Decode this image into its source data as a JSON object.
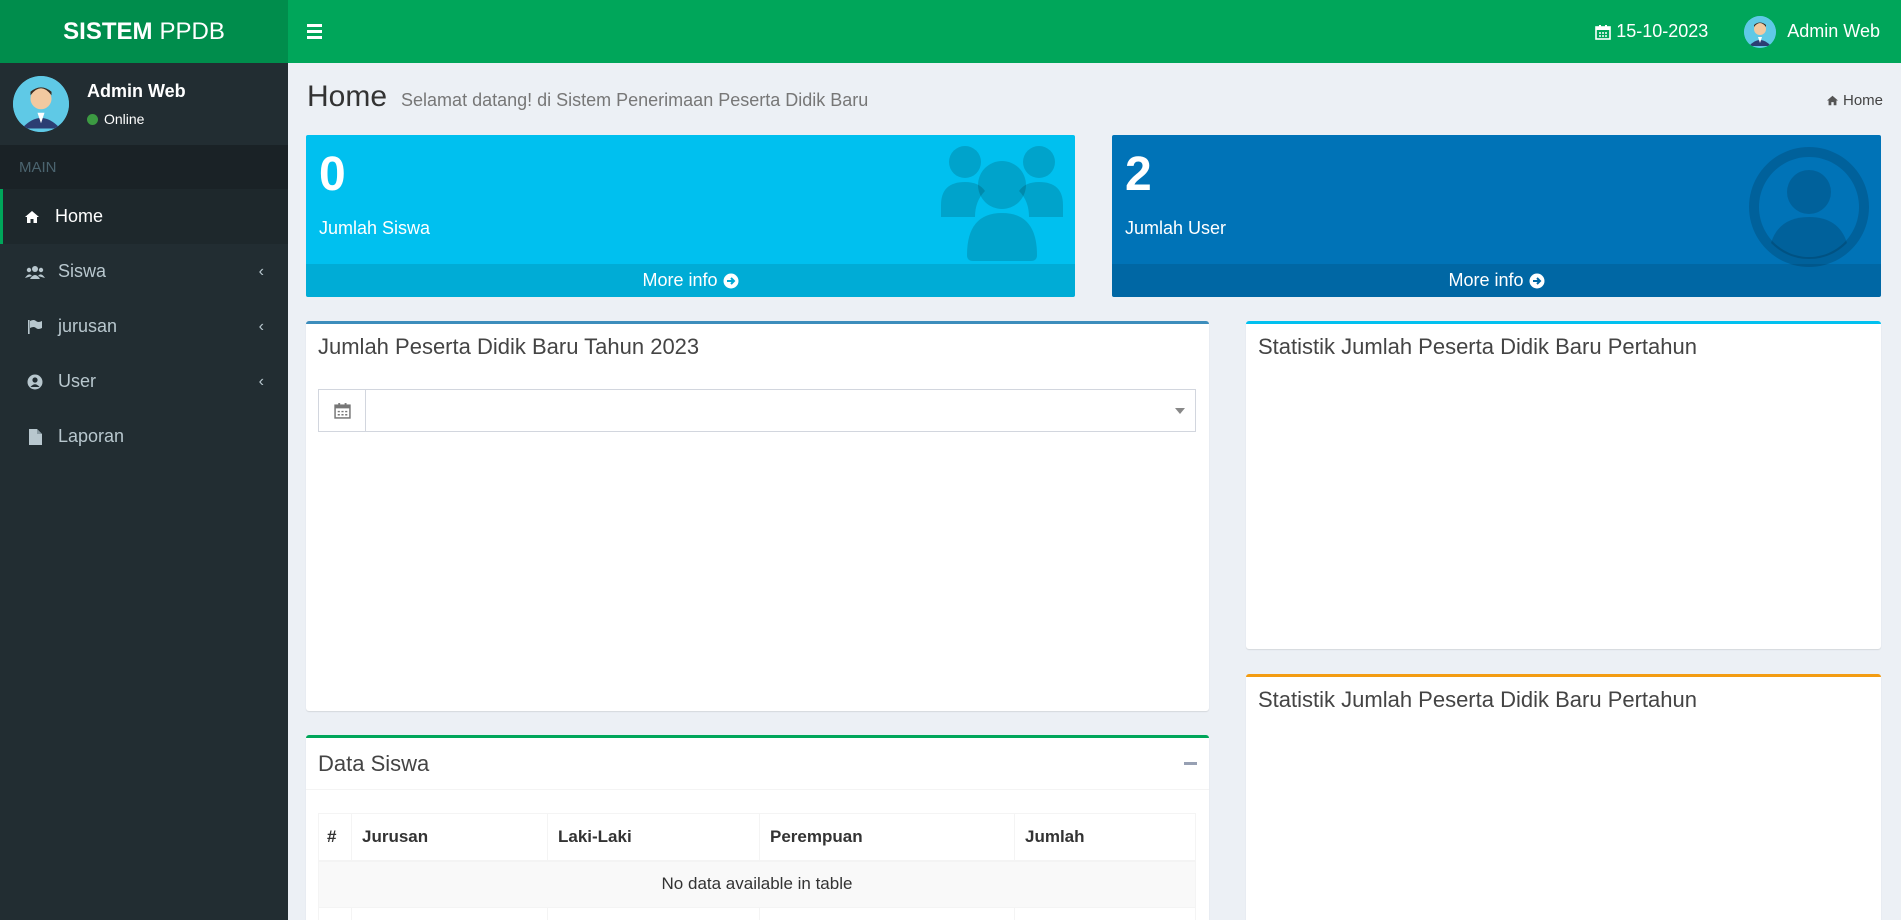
{
  "header": {
    "logo_bold": "SISTEM",
    "logo_rest": "PPDB",
    "date": "15-10-2023",
    "user_name": "Admin Web"
  },
  "sidebar": {
    "user_name": "Admin Web",
    "status": "Online",
    "section": "MAIN",
    "items": [
      {
        "label": "Home",
        "icon": "home-icon",
        "active": true
      },
      {
        "label": "Siswa",
        "icon": "users-icon",
        "has_children": true
      },
      {
        "label": "jurusan",
        "icon": "flag-icon",
        "has_children": true
      },
      {
        "label": "User",
        "icon": "user-circle-icon",
        "has_children": true
      },
      {
        "label": "Laporan",
        "icon": "file-icon"
      }
    ]
  },
  "page": {
    "title": "Home",
    "subtitle": "Selamat datang! di Sistem Penerimaan Peserta Didik Baru",
    "breadcrumb": "Home"
  },
  "stats": [
    {
      "value": "0",
      "label": "Jumlah Siswa",
      "more": "More info",
      "color": "#00c0ef"
    },
    {
      "value": "2",
      "label": "Jumlah User",
      "more": "More info",
      "color": "#0073b7"
    }
  ],
  "panels": {
    "year_chart_title": "Jumlah Peserta Didik Baru Tahun 2023",
    "stat_title_1": "Statistik Jumlah Peserta Didik Baru Pertahun",
    "stat_title_2": "Statistik Jumlah Peserta Didik Baru Pertahun",
    "data_siswa_title": "Data Siswa"
  },
  "table": {
    "columns": [
      "#",
      "Jurusan",
      "Laki-Laki",
      "Perempuan",
      "Jumlah"
    ],
    "empty_message": "No data available in table"
  }
}
